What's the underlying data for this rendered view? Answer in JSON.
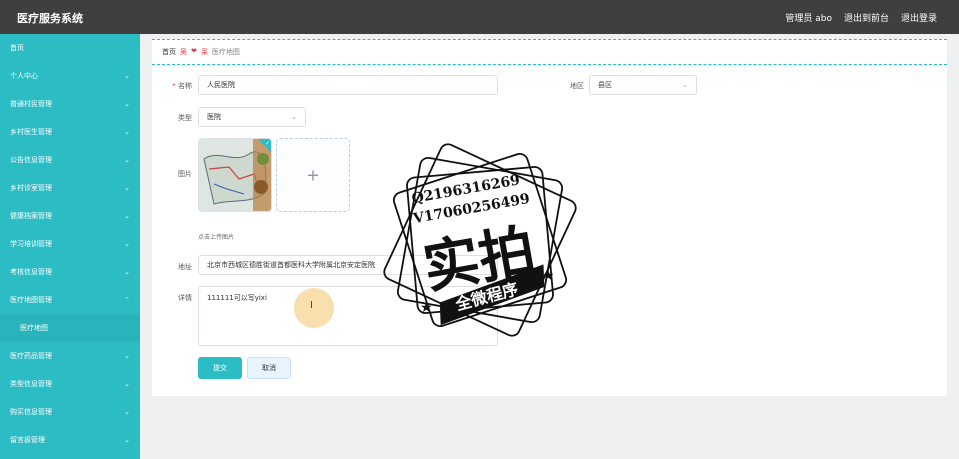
{
  "header": {
    "title": "医疗服务系统",
    "admin": "管理员 abo",
    "back_to_front": "退出到前台",
    "logout": "退出登录"
  },
  "sidebar": {
    "items": [
      {
        "label": "首页",
        "chevron": false
      },
      {
        "label": "个人中心",
        "chevron": true
      },
      {
        "label": "普通村民管理",
        "chevron": true
      },
      {
        "label": "乡村医生管理",
        "chevron": true
      },
      {
        "label": "公告信息管理",
        "chevron": true
      },
      {
        "label": "乡村诊室管理",
        "chevron": true
      },
      {
        "label": "健康档案管理",
        "chevron": true
      },
      {
        "label": "学习培训管理",
        "chevron": true
      },
      {
        "label": "考核信息管理",
        "chevron": true
      },
      {
        "label": "医疗地图管理",
        "chevron": true,
        "expanded": true
      },
      {
        "label": "医疗地图",
        "chevron": false,
        "sub": true
      },
      {
        "label": "医疗药品管理",
        "chevron": true
      },
      {
        "label": "类型信息管理",
        "chevron": true
      },
      {
        "label": "购买信息管理",
        "chevron": true
      },
      {
        "label": "留言板管理",
        "chevron": true
      }
    ]
  },
  "breadcrumb": {
    "home": "首页",
    "sep": "吴",
    "heart": "❤",
    "sep2": "呆",
    "current": "医疗地图"
  },
  "form": {
    "name_label": "名称",
    "name_value": "人民医院",
    "region_label": "地区",
    "region_value": "县区",
    "type_label": "类型",
    "type_value": "医院",
    "image_label": "图片",
    "upload_hint": "点击上传图片",
    "address_label": "地址",
    "address_value": "北京市西城区德胜街道首都医科大学附属北京安定医院",
    "detail_label": "详情",
    "detail_value": "111111可以写yixi",
    "submit": "提交",
    "cancel": "取消"
  },
  "stamp": {
    "line1": "Q2196316269",
    "line2": "V17060256499",
    "big": "实拍",
    "banner": "全微程序"
  },
  "colors": {
    "accent": "#2bbcc4",
    "topbar": "#3f3f3f"
  }
}
